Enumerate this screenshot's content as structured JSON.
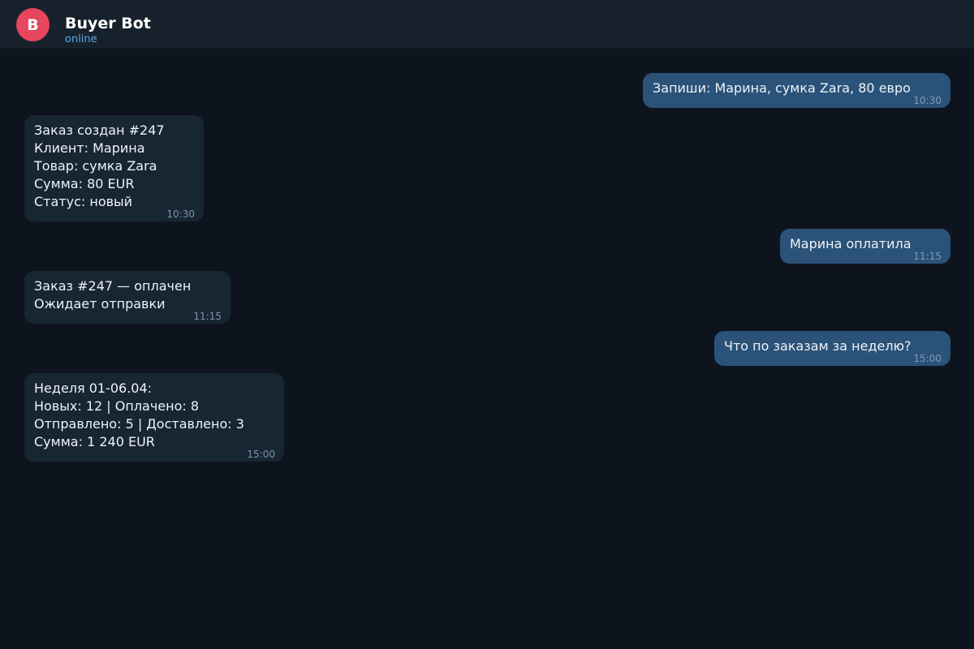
{
  "chat": {
    "avatar_letter": "B",
    "title": "Buyer Bot",
    "status": "online"
  },
  "messages": [
    {
      "direction": "out",
      "lines": [
        "Запиши: Марина, сумка Zara, 80 евро"
      ],
      "time": "10:30"
    },
    {
      "direction": "in",
      "lines": [
        "Заказ создан #247",
        "Клиент: Марина",
        "Товар: сумка Zara",
        "Сумма: 80 EUR",
        "Статус: новый"
      ],
      "time": "10:30"
    },
    {
      "direction": "out",
      "lines": [
        "Марина оплатила"
      ],
      "time": "11:15"
    },
    {
      "direction": "in",
      "lines": [
        "Заказ #247 — оплачен",
        "Ожидает отправки"
      ],
      "time": "11:15"
    },
    {
      "direction": "out",
      "lines": [
        "Что по заказам за неделю?"
      ],
      "time": "15:00"
    },
    {
      "direction": "in",
      "lines": [
        "Неделя 01-06.04:",
        "Новых: 12 | Оплачено: 8",
        "Отправлено: 5 | Доставлено: 3",
        "Сумма: 1 240 EUR"
      ],
      "time": "15:00"
    }
  ]
}
